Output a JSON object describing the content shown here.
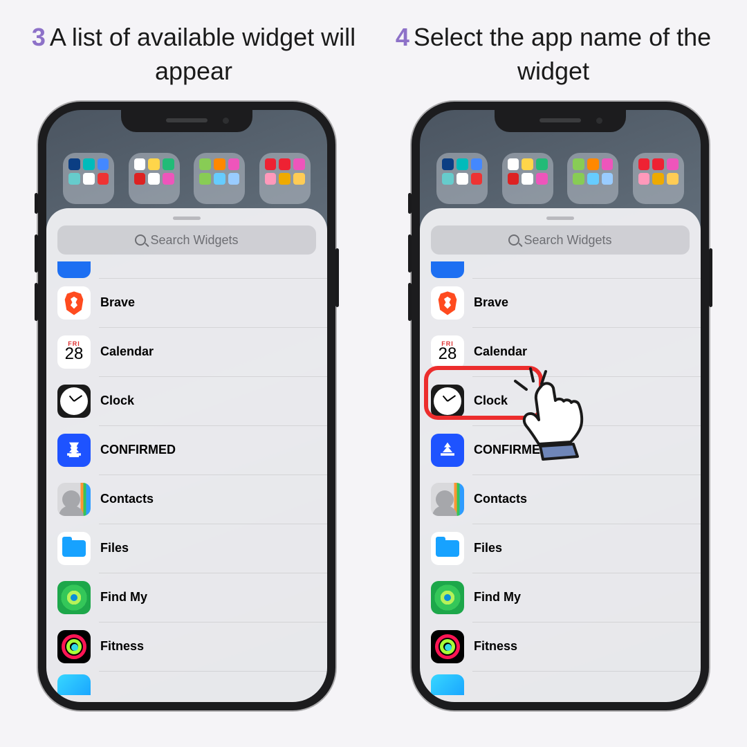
{
  "steps": [
    {
      "number": "3",
      "text": "A list of available widget will appear"
    },
    {
      "number": "4",
      "text": "Select the app name of the widget"
    }
  ],
  "search_placeholder": "Search Widgets",
  "calendar": {
    "day": "FRI",
    "date": "28"
  },
  "rows": [
    {
      "key": "brave",
      "label": "Brave"
    },
    {
      "key": "calendar",
      "label": "Calendar"
    },
    {
      "key": "clock",
      "label": "Clock"
    },
    {
      "key": "confirmed",
      "label": "CONFIRMED"
    },
    {
      "key": "contacts",
      "label": "Contacts"
    },
    {
      "key": "files",
      "label": "Files"
    },
    {
      "key": "findmy",
      "label": "Find My"
    },
    {
      "key": "fitness",
      "label": "Fitness"
    }
  ],
  "highlight_row_key": "clock",
  "colors": {
    "accent_number": "#8d71c8",
    "highlight_border": "#ec2d2d"
  }
}
